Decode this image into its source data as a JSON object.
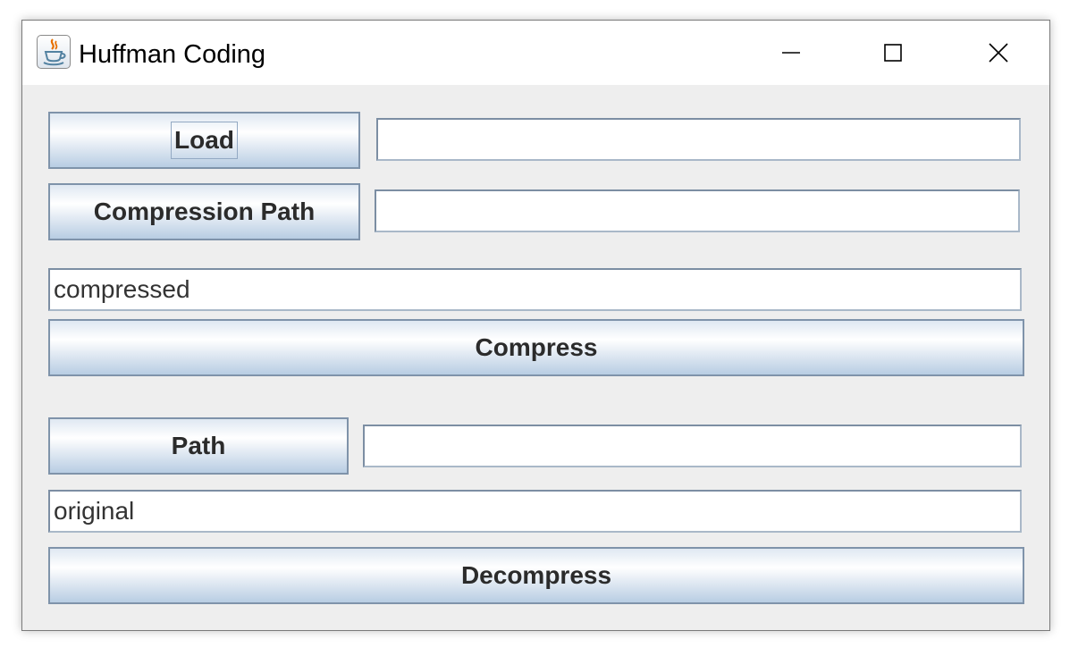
{
  "window": {
    "title": "Huffman Coding",
    "icon": "java-cup-icon",
    "controls": [
      "minimize-icon",
      "maximize-icon",
      "close-icon"
    ]
  },
  "compress_section": {
    "load_button": "Load",
    "load_path_value": "",
    "compression_path_button": "Compression Path",
    "compression_path_value": "",
    "output_name_value": "compressed",
    "compress_button": "Compress"
  },
  "decompress_section": {
    "path_button": "Path",
    "path_value": "",
    "output_name_value": "original",
    "decompress_button": "Decompress"
  }
}
